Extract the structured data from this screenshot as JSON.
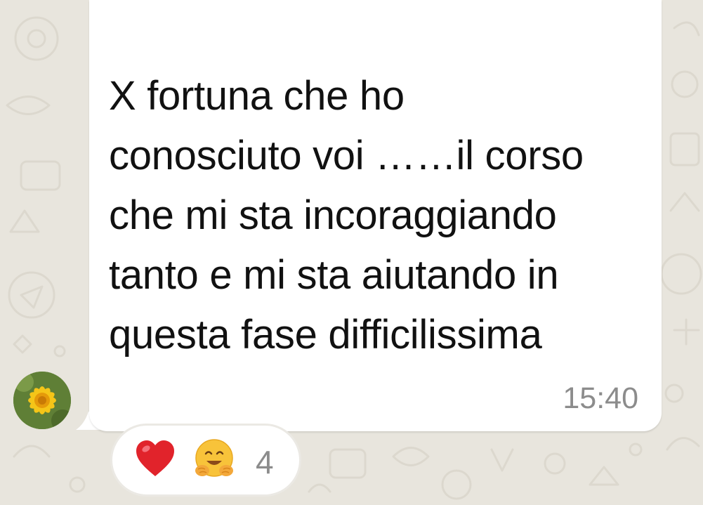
{
  "chat": {
    "message": {
      "lines": [
        "X fortuna che ho",
        "conosciuto voi ……il corso",
        "che mi sta incoraggiando",
        "tanto e mi sta aiutando in",
        "questa fase difficilissima"
      ],
      "time": "15:40"
    },
    "sender_avatar": "sunflower-photo",
    "reactions": {
      "emojis": [
        "red-heart",
        "hugging-face"
      ],
      "count": "4"
    }
  },
  "colors": {
    "wallpaper": "#e8e5dd",
    "bubble": "#ffffff",
    "text": "#111111",
    "meta_text": "#8c8c8c"
  }
}
